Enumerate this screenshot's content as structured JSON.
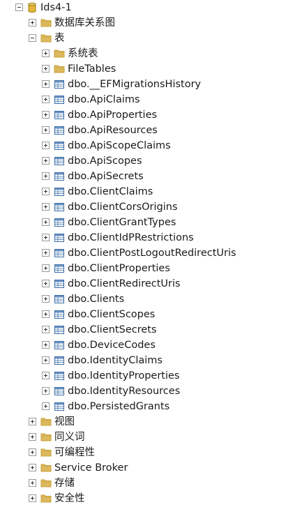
{
  "database": {
    "label": "Ids4-1",
    "icon": "database-icon",
    "expanded": true
  },
  "db_children_before": [
    {
      "label": "数据库关系图",
      "icon": "folder-icon",
      "expanded": false
    }
  ],
  "tables_folder": {
    "label": "表",
    "icon": "folder-icon",
    "expanded": true
  },
  "table_folders": [
    {
      "label": "系统表",
      "icon": "folder-icon",
      "expanded": false
    },
    {
      "label": "FileTables",
      "icon": "folder-icon",
      "expanded": false
    }
  ],
  "tables": [
    "dbo.__EFMigrationsHistory",
    "dbo.ApiClaims",
    "dbo.ApiProperties",
    "dbo.ApiResources",
    "dbo.ApiScopeClaims",
    "dbo.ApiScopes",
    "dbo.ApiSecrets",
    "dbo.ClientClaims",
    "dbo.ClientCorsOrigins",
    "dbo.ClientGrantTypes",
    "dbo.ClientIdPRestrictions",
    "dbo.ClientPostLogoutRedirectUris",
    "dbo.ClientProperties",
    "dbo.ClientRedirectUris",
    "dbo.Clients",
    "dbo.ClientScopes",
    "dbo.ClientSecrets",
    "dbo.DeviceCodes",
    "dbo.IdentityClaims",
    "dbo.IdentityProperties",
    "dbo.IdentityResources",
    "dbo.PersistedGrants"
  ],
  "db_children_after": [
    {
      "label": "视图",
      "icon": "folder-icon",
      "expanded": false
    },
    {
      "label": "同义词",
      "icon": "folder-icon",
      "expanded": false
    },
    {
      "label": "可编程性",
      "icon": "folder-icon",
      "expanded": false
    },
    {
      "label": "Service Broker",
      "icon": "folder-icon",
      "expanded": false
    },
    {
      "label": "存储",
      "icon": "folder-icon",
      "expanded": false
    },
    {
      "label": "安全性",
      "icon": "folder-icon",
      "expanded": false
    }
  ],
  "colors": {
    "folder": "#dcb95c",
    "folder_dark": "#c9a13d",
    "table_border": "#3a6ea5",
    "table_header": "#6d93c4",
    "database": "#e0b63b",
    "text": "#1a1a1a"
  }
}
